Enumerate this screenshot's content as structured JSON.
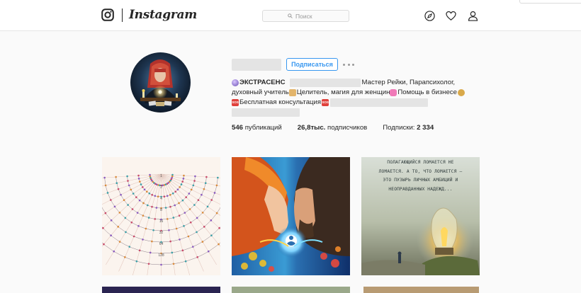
{
  "nav": {
    "brand": "Instagram",
    "search_placeholder": "Поиск",
    "icons": [
      "instagram-logo-icon",
      "explore-compass-icon",
      "activity-heart-icon",
      "profile-user-icon"
    ]
  },
  "profile": {
    "follow_label": "Подписаться",
    "bio": {
      "name_label": "ЭКСТРАСЕНС",
      "line1_tail": "Мастер Рейки, Парапсихолог,",
      "line2_a": "духовный учитель",
      "line2_b": "Целитель, магия для женщин",
      "line2_c": "Помощь в бизнесе",
      "line3_a": "Бесплатная консультация",
      "emoji_sos": "SOS"
    },
    "stats": {
      "posts_count": "546",
      "posts_label": "публикаций",
      "followers_count": "26,8тыс.",
      "followers_label": "подписчиков",
      "following_label": "Подписки:",
      "following_count": "2 334"
    }
  },
  "posts": {
    "quote_lines": [
      "ПОЛАГАЮЩИЙСЯ ЛОМАЕТСЯ НЕ",
      "ЛОМАЕТСЯ. А ТО, ЧТО ЛОМАЕТСЯ –",
      "ЭТО ПУЗЫРЬ ЛИЧНЫХ АМБИЦИЙ И",
      "НЕОПРАВДАННЫХ НАДЕЖД..."
    ],
    "chart_numbers": [
      "1",
      "2",
      "4",
      "8",
      "16",
      "32",
      "64",
      "128"
    ]
  },
  "colors": {
    "accent": "#3897f0",
    "text": "#262626",
    "muted": "#999999",
    "background": "#fafafa"
  }
}
